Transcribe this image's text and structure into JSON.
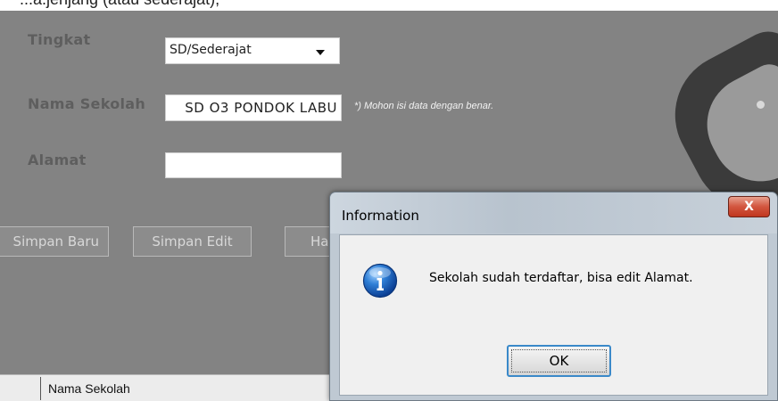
{
  "top_strip": {
    "partial_text": "...a.jenjang (atau sederajat),"
  },
  "form": {
    "tingkat_label": "Tingkat",
    "tingkat_value": "SD/Sederajat",
    "nama_sekolah_label": "Nama Sekolah",
    "nama_sekolah_value": "SD O3 PONDOK LABU",
    "hint": "*) Mohon isi data dengan benar.",
    "alamat_label": "Alamat",
    "alamat_value": "",
    "buttons": {
      "simpan_baru": "Simpan Baru",
      "simpan_edit": "Simpan Edit",
      "hapus": "Hapus"
    }
  },
  "status_bar": {
    "column_label": "Nama Sekolah"
  },
  "dialog": {
    "title": "Information",
    "close_label": "X",
    "message": "Sekolah sudah terdaftar, bisa edit Alamat.",
    "ok_label": "OK",
    "icon": "info-icon"
  },
  "colors": {
    "form_background": "#838383",
    "label_color": "#5e5e5e",
    "dialog_focus": "#3a89c9",
    "close_button": "#c0371f"
  }
}
